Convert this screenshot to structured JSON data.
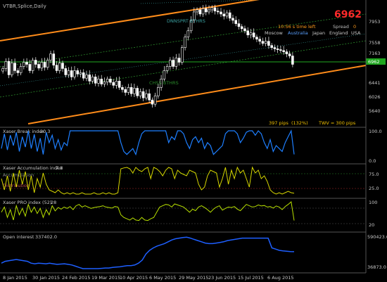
{
  "chart_data": [
    {
      "type": "candlestick",
      "title": "VTBR,Splice,Daily",
      "price_label": "6962",
      "info": {
        "countdown": "10:56 s time left",
        "spread_label": "Spread",
        "spread_value": "0",
        "sessions": [
          "Moscow",
          "Australia",
          "Japan",
          "England",
          "USA"
        ],
        "active_session": "Australia",
        "pips": "397 pips",
        "pips_pct": "(132%)",
        "twv": "TWV = 300 pips"
      },
      "y_ticks": [
        "7953",
        "7558",
        "7163",
        "6962",
        "6441",
        "6026",
        "5640"
      ],
      "channel_labels": [
        "DNNSPRT BTHRS",
        "CHSS BTHRS"
      ],
      "ylim": [
        5500,
        8250
      ],
      "close": [
        6750,
        6920,
        6600,
        6880,
        6700,
        6650,
        6800,
        6900,
        6850,
        6700,
        6950,
        6850,
        6760,
        6900,
        6780,
        6950,
        7100,
        6830,
        6700,
        6880,
        6750,
        6600,
        6700,
        6550,
        6700,
        6620,
        6650,
        6520,
        6600,
        6450,
        6550,
        6400,
        6500,
        6380,
        6430,
        6500,
        6420,
        6350,
        6450,
        6300,
        6250,
        6180,
        6300,
        6150,
        6280,
        6100,
        6200,
        6050,
        6150,
        6000,
        5900,
        6100,
        6300,
        6500,
        6700,
        6800,
        6950,
        6800,
        7000,
        6900,
        7250,
        7500,
        7650,
        7900,
        8100,
        8150,
        8050,
        8180,
        8100,
        8150,
        8200,
        8120,
        8100,
        8050,
        8000,
        8080,
        7950,
        7900,
        7820,
        7750,
        7700,
        7650,
        7550,
        7600,
        7500,
        7450,
        7400,
        7350,
        7400,
        7300,
        7250,
        7220,
        7200,
        7180,
        7150,
        7100,
        7050,
        6850
      ]
    },
    {
      "type": "line",
      "title": "Xaser Break index",
      "value": "20.3",
      "y_ticks": [
        "100.0",
        "0.0"
      ],
      "ylim": [
        0,
        100
      ],
      "series": [
        {
          "values": [
            40,
            90,
            35,
            85,
            50,
            95,
            30,
            80,
            45,
            100,
            40,
            88,
            30,
            75,
            20,
            95,
            60,
            85,
            40,
            70,
            35,
            60,
            50,
            100,
            100,
            100,
            100,
            100,
            100,
            100,
            100,
            100,
            100,
            100,
            100,
            100,
            100,
            100,
            100,
            100,
            60,
            30,
            20,
            30,
            40,
            20,
            60,
            90,
            100,
            100,
            100,
            100,
            100,
            100,
            100,
            100,
            60,
            80,
            70,
            100,
            100,
            90,
            60,
            40,
            70,
            80,
            60,
            75,
            40,
            60,
            50,
            20,
            30,
            40,
            50,
            90,
            100,
            100,
            100,
            90,
            60,
            75,
            95,
            100,
            100,
            85,
            100,
            90,
            60,
            40,
            70,
            30,
            50,
            40,
            30,
            60,
            80,
            100,
            20
          ]
        }
      ]
    },
    {
      "type": "line",
      "title": "Xaser Accumulation index",
      "value": "7.8",
      "levels": [
        "Accumulation",
        "Distribution"
      ],
      "y_ticks": [
        "75.0",
        "25.0"
      ],
      "ylim": [
        0,
        100
      ],
      "series": [
        {
          "values": [
            60,
            20,
            70,
            15,
            80,
            30,
            90,
            40,
            85,
            20,
            70,
            10,
            60,
            30,
            80,
            40,
            20,
            15,
            10,
            20,
            10,
            5,
            10,
            5,
            10,
            5,
            5,
            10,
            5,
            5,
            5,
            10,
            5,
            5,
            10,
            5,
            10,
            5,
            5,
            10,
            95,
            98,
            100,
            95,
            80,
            100,
            90,
            85,
            95,
            100,
            60,
            100,
            95,
            85,
            70,
            90,
            100,
            95,
            60,
            90,
            80,
            75,
            70,
            90,
            85,
            80,
            40,
            20,
            30,
            70,
            90,
            85,
            80,
            30,
            60,
            100,
            40,
            90,
            60,
            100,
            80,
            90,
            60,
            30,
            100,
            80,
            90,
            60,
            70,
            50,
            20,
            10,
            5,
            10,
            5,
            10,
            15,
            10,
            8
          ]
        }
      ]
    },
    {
      "type": "line",
      "title": "Xaser PRO index (52)",
      "value": "28",
      "y_ticks": [
        "100",
        "20"
      ],
      "ylim": [
        0,
        100
      ],
      "series": [
        {
          "values": [
            60,
            80,
            40,
            70,
            30,
            85,
            50,
            75,
            45,
            90,
            60,
            80,
            55,
            75,
            40,
            70,
            50,
            85,
            65,
            78,
            72,
            80,
            75,
            82,
            70,
            85,
            90,
            80,
            85,
            80,
            75,
            78,
            80,
            82,
            85,
            80,
            78,
            76,
            82,
            80,
            50,
            40,
            35,
            30,
            38,
            30,
            28,
            40,
            30,
            28,
            35,
            40,
            60,
            80,
            85,
            90,
            88,
            80,
            92,
            88,
            84,
            80,
            70,
            60,
            72,
            66,
            80,
            85,
            78,
            70,
            60,
            72,
            80,
            85,
            68,
            75,
            80,
            78,
            82,
            72,
            66,
            78,
            90,
            85,
            80,
            82,
            88,
            84,
            86,
            80,
            82,
            76,
            84,
            80,
            70,
            82,
            90,
            100,
            28
          ]
        }
      ]
    },
    {
      "type": "line",
      "title": "Open interest",
      "value": "337402.0",
      "y_ticks": [
        "590423.0",
        "36873.0"
      ],
      "ylim": [
        36873,
        590423
      ],
      "series": [
        {
          "values": [
            150000,
            180000,
            190000,
            200000,
            210000,
            200000,
            190000,
            180000,
            150000,
            140000,
            150000,
            145000,
            140000,
            150000,
            140000,
            130000,
            135000,
            140000,
            130000,
            120000,
            100000,
            80000,
            60000,
            60000,
            60000,
            60000,
            60000,
            65000,
            70000,
            70000,
            80000,
            85000,
            90000,
            100000,
            110000,
            110000,
            120000,
            150000,
            200000,
            300000,
            360000,
            400000,
            430000,
            450000,
            470000,
            500000,
            530000,
            550000,
            560000,
            570000,
            575000,
            560000,
            540000,
            520000,
            500000,
            480000,
            470000,
            470000,
            480000,
            490000,
            500000,
            520000,
            530000,
            540000,
            550000,
            560000,
            560000,
            560000,
            560000,
            560000,
            560000,
            560000,
            560000,
            400000,
            380000,
            360000,
            350000,
            345000,
            340000,
            337402
          ]
        }
      ]
    }
  ],
  "x_ticks": [
    "8 Jan 2015",
    "30 Jan 2015",
    "24 Feb 2015",
    "19 Mar 2015",
    "10 Apr 2015",
    "6 May 2015",
    "29 May 2015",
    "23 Jun 2015",
    "15 Jul 2015",
    "6 Aug 2015"
  ],
  "colors": {
    "background": "#000000",
    "candle": "#ffffff",
    "channel": "#ff8c1a",
    "channel_mid": "#2a8a2a",
    "price_line": "#22aa22",
    "break_line": "#1e7fff",
    "accumulation_line": "#d6d600",
    "pro_line": "#b8e000",
    "oi_line": "#1e5fff",
    "price_badge": "#1fa61f",
    "big_price": "#ff2a2a"
  }
}
